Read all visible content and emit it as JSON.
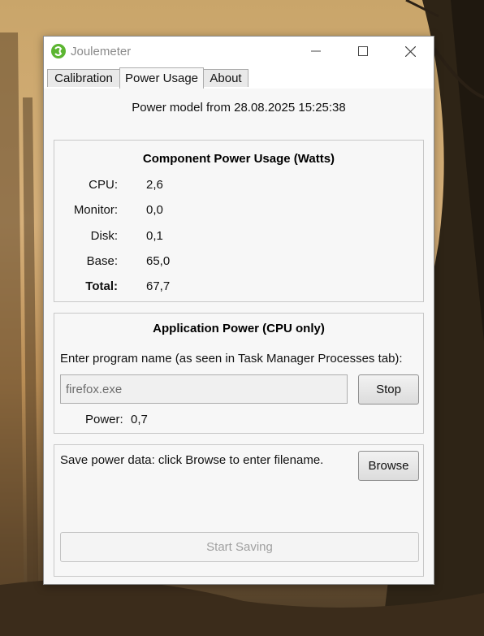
{
  "window": {
    "title": "Joulemeter",
    "controls": {
      "minimize": "—",
      "maximize": "☐",
      "close": "✕"
    }
  },
  "tabs": [
    {
      "label": "Calibration",
      "active": false
    },
    {
      "label": "Power Usage",
      "active": true
    },
    {
      "label": "About",
      "active": false
    }
  ],
  "power_usage": {
    "model_line": "Power model from 28.08.2025 15:25:38",
    "component": {
      "title": "Component Power Usage (Watts)",
      "rows": [
        {
          "label": "CPU:",
          "value": "2,6"
        },
        {
          "label": "Monitor:",
          "value": "0,0"
        },
        {
          "label": "Disk:",
          "value": "0,1"
        },
        {
          "label": "Base:",
          "value": "65,0"
        },
        {
          "label": "Total:",
          "value": "67,7"
        }
      ]
    },
    "application": {
      "title": "Application Power (CPU only)",
      "prompt": "Enter program name (as seen in Task Manager Processes tab):",
      "program_value": "firefox.exe",
      "stop_label": "Stop",
      "power_label": "Power:",
      "power_value": "0,7"
    },
    "save": {
      "prompt": "Save power data: click Browse to enter filename.",
      "browse_label": "Browse",
      "start_label": "Start Saving"
    }
  },
  "colors": {
    "accent_icon": "#5cb531",
    "window_bg": "#f7f7f7"
  }
}
